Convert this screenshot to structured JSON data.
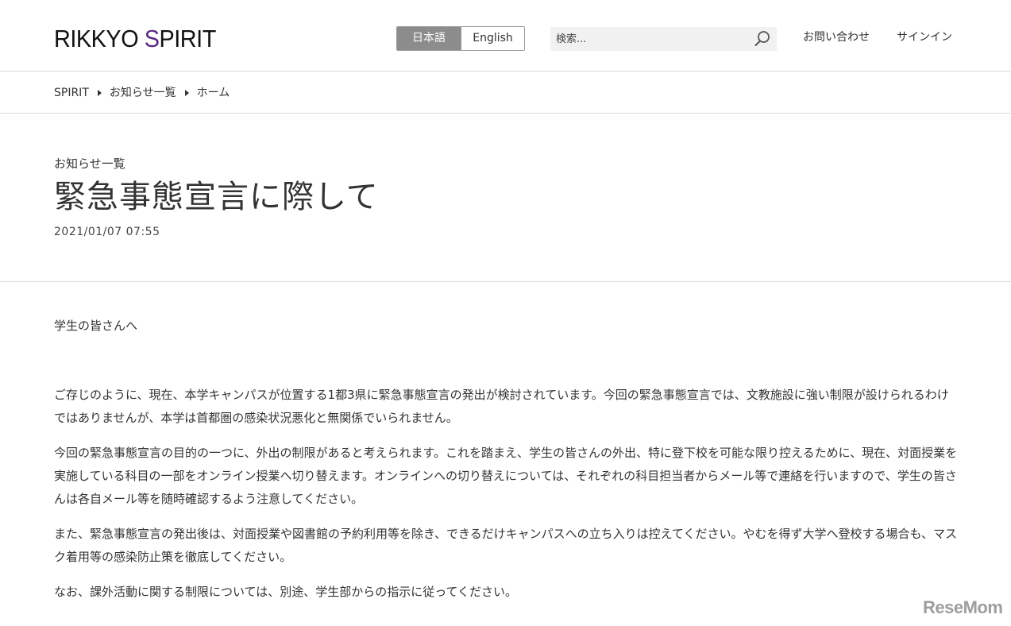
{
  "header": {
    "logo": {
      "part1": "RIKKYO ",
      "accent_letter": "S",
      "part2": "PIRIT",
      "accent_color": "#5a2a82"
    },
    "language": {
      "japanese_label": "日本語",
      "english_label": "English",
      "active": "日本語"
    },
    "search": {
      "placeholder": "検索...",
      "icon": "search-icon"
    },
    "contact_label": "お問い合わせ",
    "signin_label": "サインイン"
  },
  "breadcrumb": {
    "items": [
      "SPIRIT",
      "お知らせ一覧",
      "ホーム"
    ],
    "separator_icon": "caret-right-icon"
  },
  "article": {
    "category": "お知らせ一覧",
    "title": "緊急事態宣言に際して",
    "timestamp": "2021/01/07 07:55",
    "greeting": "学生の皆さんへ",
    "paragraphs": [
      "ご存じのように、現在、本学キャンパスが位置する1都3県に緊急事態宣言の発出が検討されています。今回の緊急事態宣言では、文教施設に強い制限が設けられるわけではありませんが、本学は首都圏の感染状況悪化と無関係でいられません。",
      "今回の緊急事態宣言の目的の一つに、外出の制限があると考えられます。これを踏まえ、学生の皆さんの外出、特に登下校を可能な限り控えるために、現在、対面授業を実施している科目の一部をオンライン授業へ切り替えます。オンラインへの切り替えについては、それぞれの科目担当者からメール等で連絡を行いますので、学生の皆さんは各自メール等を随時確認するよう注意してください。",
      "また、緊急事態宣言の発出後は、対面授業や図書館の予約利用等を除き、できるだけキャンパスへの立ち入りは控えてください。やむを得ず大学へ登校する場合も、マスク着用等の感染防止策を徹底してください。",
      "なお、課外活動に関する制限については、別途、学生部からの指示に従ってください。"
    ]
  },
  "watermark": "ReseMom"
}
